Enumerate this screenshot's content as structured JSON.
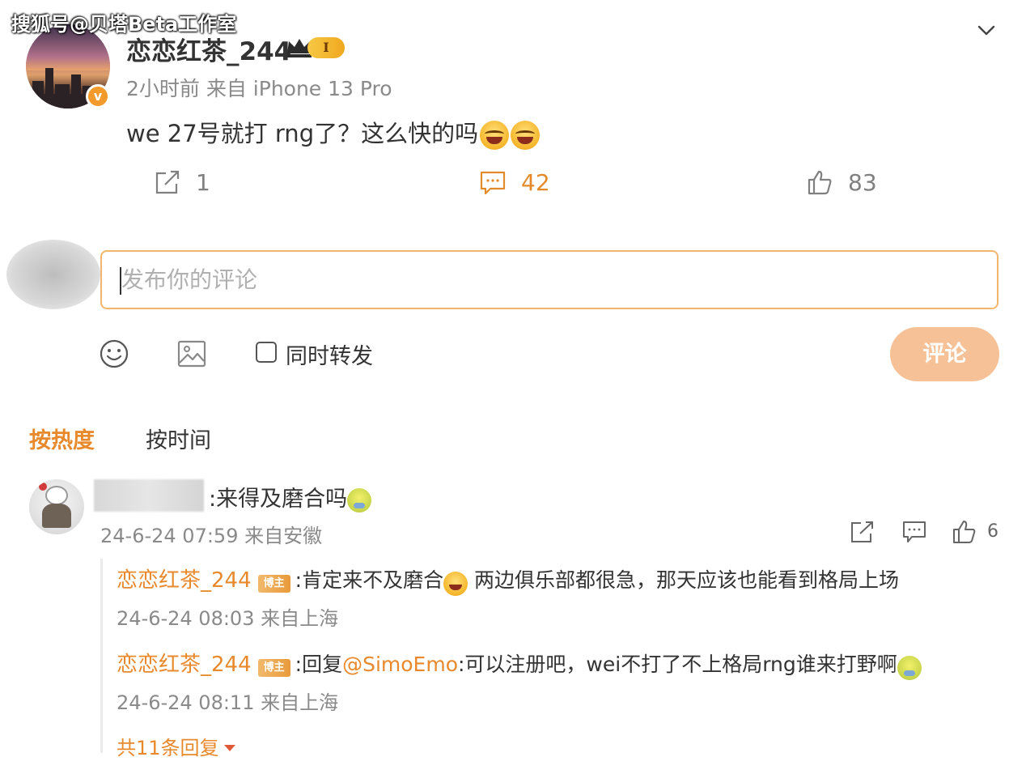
{
  "watermark": "搜狐号@贝塔Beta工作室",
  "post": {
    "author": "恋恋红茶_244",
    "level_badge": "I",
    "verified_mark": "v",
    "meta": "2小时前  来自 iPhone 13 Pro",
    "content": "we 27号就打 rng了？这么快的吗",
    "emojis": [
      "laugh-cry-emoji",
      "laugh-cry-emoji"
    ],
    "actions": {
      "repost_count": "1",
      "comment_count": "42",
      "like_count": "83"
    }
  },
  "composer": {
    "placeholder": "发布你的评论",
    "repost_label": "同时转发",
    "submit_label": "评论"
  },
  "sort_tabs": {
    "hot": "按热度",
    "time": "按时间"
  },
  "comments": [
    {
      "text": ":来得及磨合吗",
      "meta": "24-6-24 07:59 来自安徽",
      "like_count": "6",
      "replies": [
        {
          "author": "恋恋红茶_244",
          "badge": "博主",
          "text_before": ":肯定来不及磨合",
          "text_after": " 两边俱乐部都很急，那天应该也能看到格局上场",
          "meta": "24-6-24 08:03 来自上海"
        },
        {
          "author": "恋恋红茶_244",
          "badge": "博主",
          "prefix": ":回复",
          "mention": "@SimoEmo",
          "text": ":可以注册吧，wei不打了不上格局rng谁来打野啊",
          "meta": "24-6-24 08:11 来自上海"
        }
      ],
      "more_replies": "共11条回复"
    }
  ],
  "colors": {
    "accent": "#e8892c",
    "submit_bg": "#f7c197",
    "input_border": "#f1b66c",
    "meta_gray": "#8a8a8a"
  }
}
